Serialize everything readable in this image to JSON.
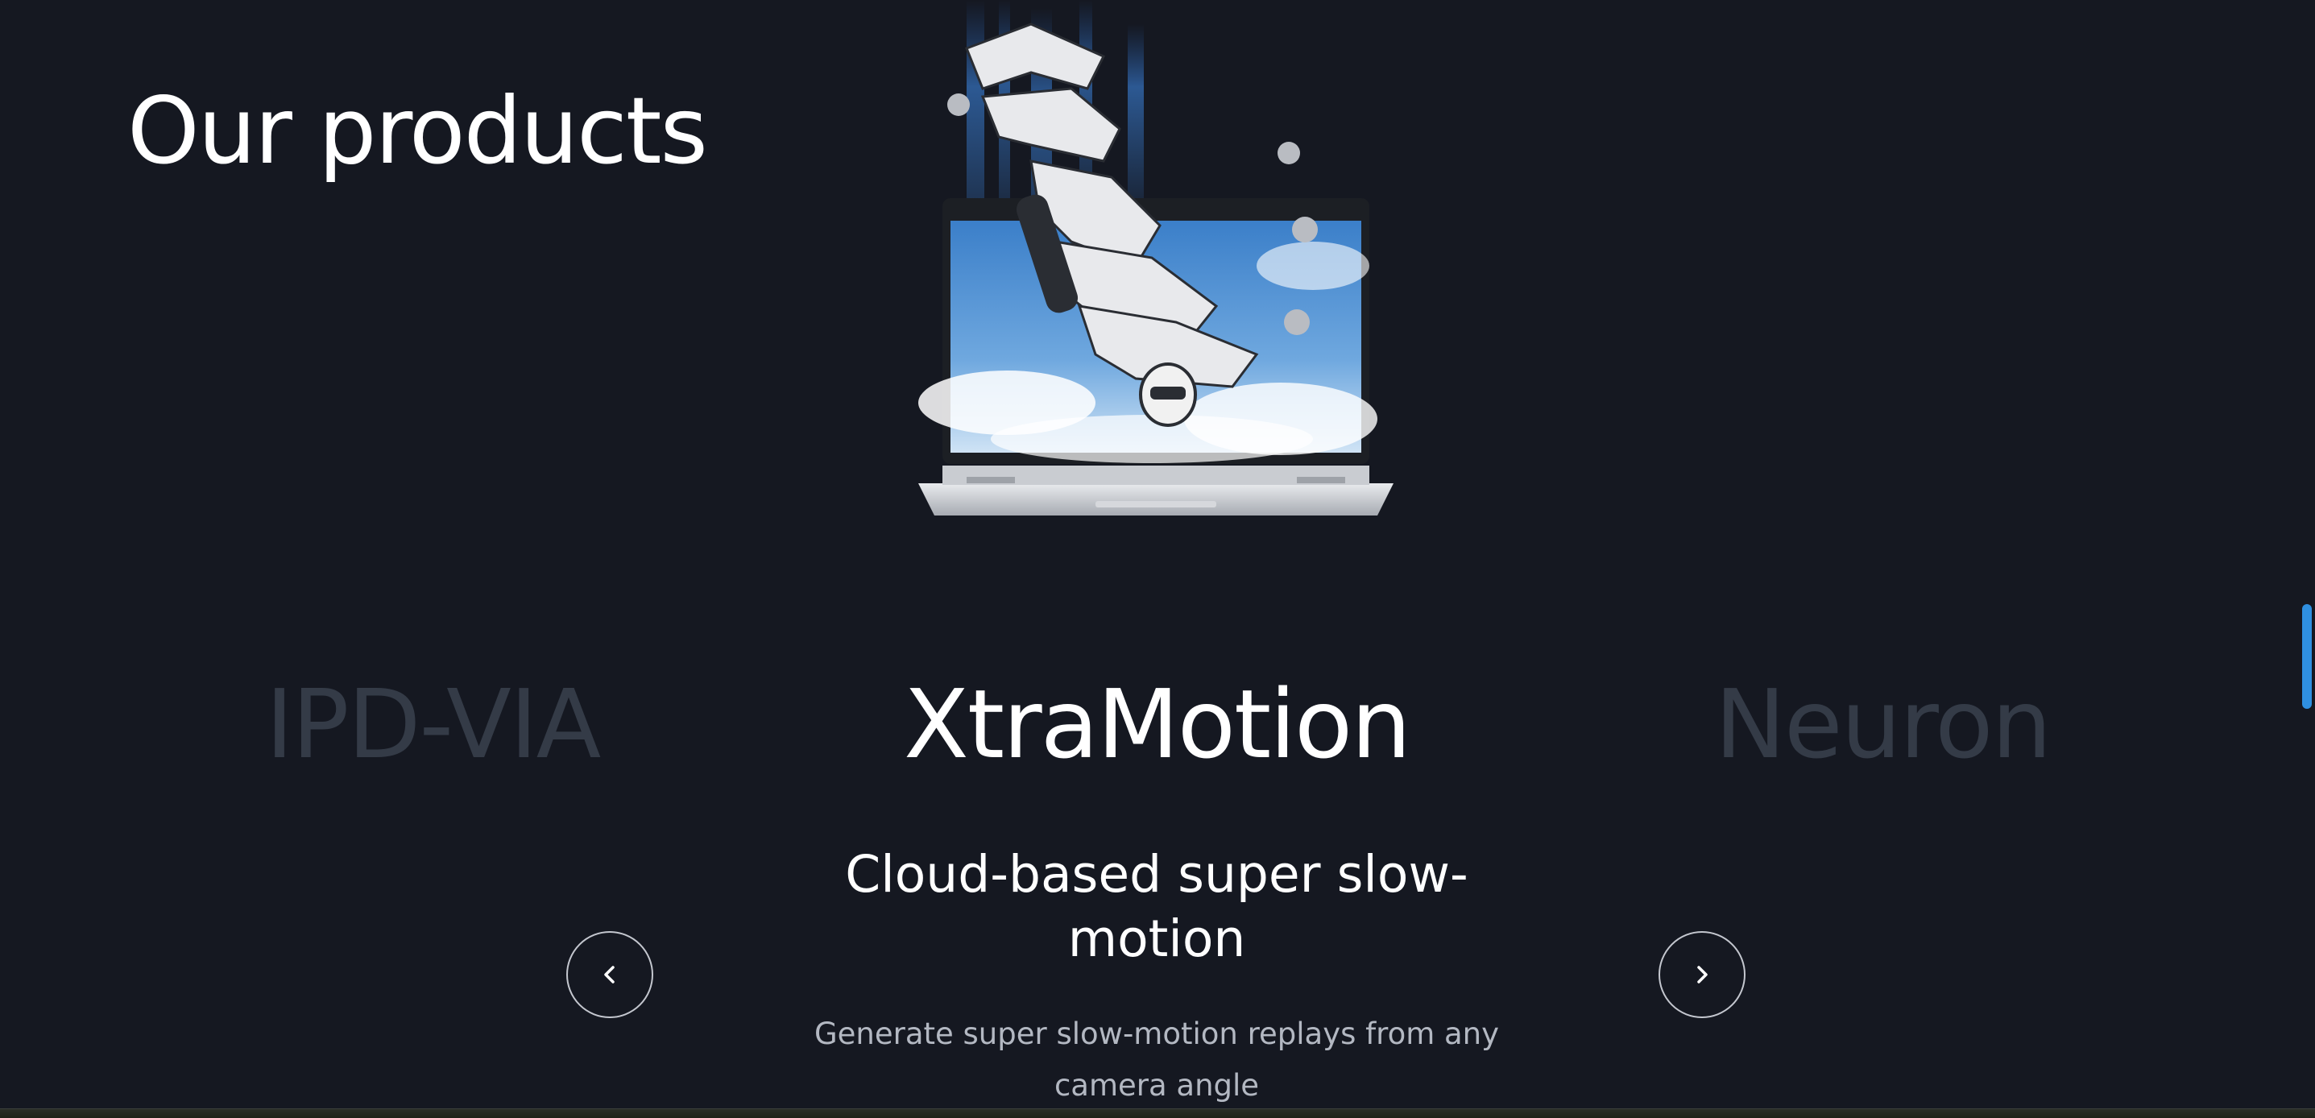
{
  "section": {
    "title": "Our products"
  },
  "carousel": {
    "products": [
      {
        "name": "IPD-VIA",
        "state": "inactive"
      },
      {
        "name": "XtraMotion",
        "state": "active"
      },
      {
        "name": "Neuron",
        "state": "inactive"
      }
    ],
    "active": {
      "tagline": "Cloud-based super slow-motion",
      "description": "Generate super slow-motion replays from any camera angle"
    },
    "prev_icon": "chevron-left-icon",
    "next_icon": "chevron-right-icon"
  },
  "colors": {
    "background": "#151821",
    "inactive_name": "#343b47",
    "active_text": "#ffffff",
    "muted_text": "#b3b8c2",
    "scrollbar": "#2f8fe0"
  }
}
